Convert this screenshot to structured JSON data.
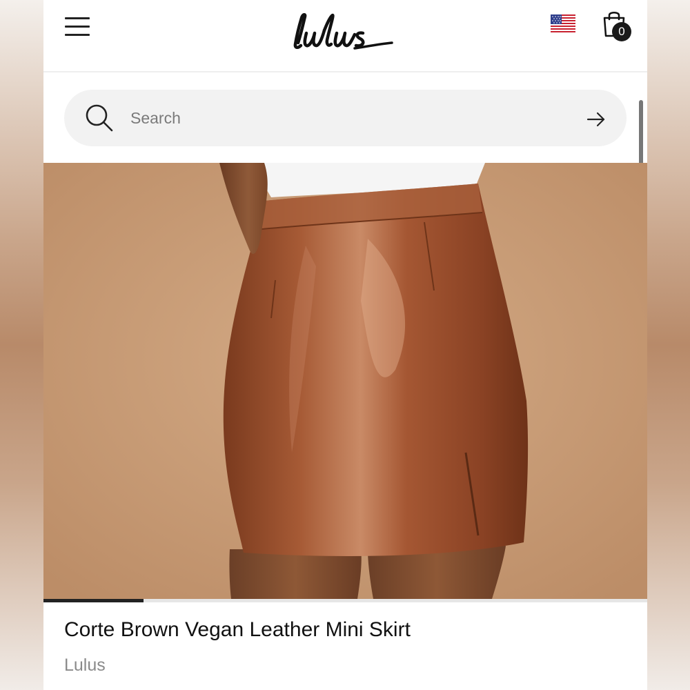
{
  "header": {
    "logo_text": "Lulus",
    "cart_count": "0",
    "menu_icon": "hamburger-menu-icon",
    "region_icon": "us-flag-icon",
    "cart_icon": "shopping-bag-icon"
  },
  "search": {
    "placeholder": "Search",
    "search_icon": "search-icon",
    "submit_icon": "arrow-right-icon"
  },
  "product": {
    "title": "Corte Brown Vegan Leather Mini Skirt",
    "brand": "Lulus",
    "image_alt": "Brown vegan leather mini skirt",
    "carousel_progress": 0.166
  },
  "colors": {
    "background_tan": "#c89d78",
    "skirt_brown": "#9c5533",
    "text_primary": "#111111",
    "text_secondary": "#8a8a8a",
    "search_bg": "#f2f2f2"
  }
}
